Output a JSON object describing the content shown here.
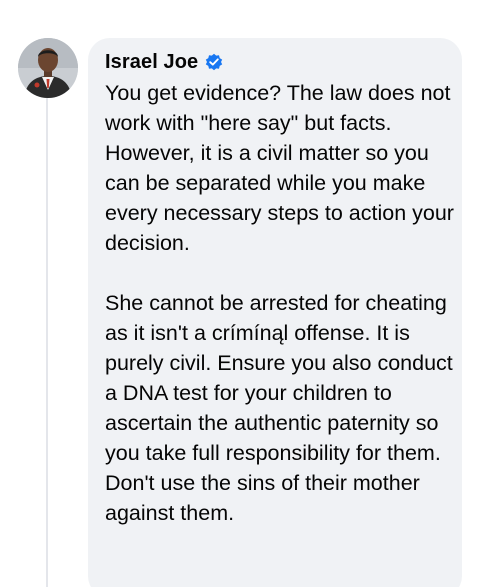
{
  "comment": {
    "author": "Israel Joe",
    "verified": true,
    "verified_badge_color": "#1877f2",
    "body_paragraph_1": "You get evidence? The law does not work with \"here say\" but facts. However, it is a civil matter so you can be separated while you make every necessary steps to action your decision.",
    "body_paragraph_2": "She cannot be arrested for cheating as it isn't a crímínąl offense. It is purely civil. Ensure you also conduct a DNA test for your children to ascertain the authentic paternity so you take full responsibility for them. Don't use the sins of their mother against them."
  },
  "icons": {
    "verified": "verified-badge-icon",
    "avatar": "profile-photo"
  },
  "colors": {
    "bubble_background": "#f0f2f5",
    "text": "#050505",
    "thread_line": "#e4e6eb"
  }
}
